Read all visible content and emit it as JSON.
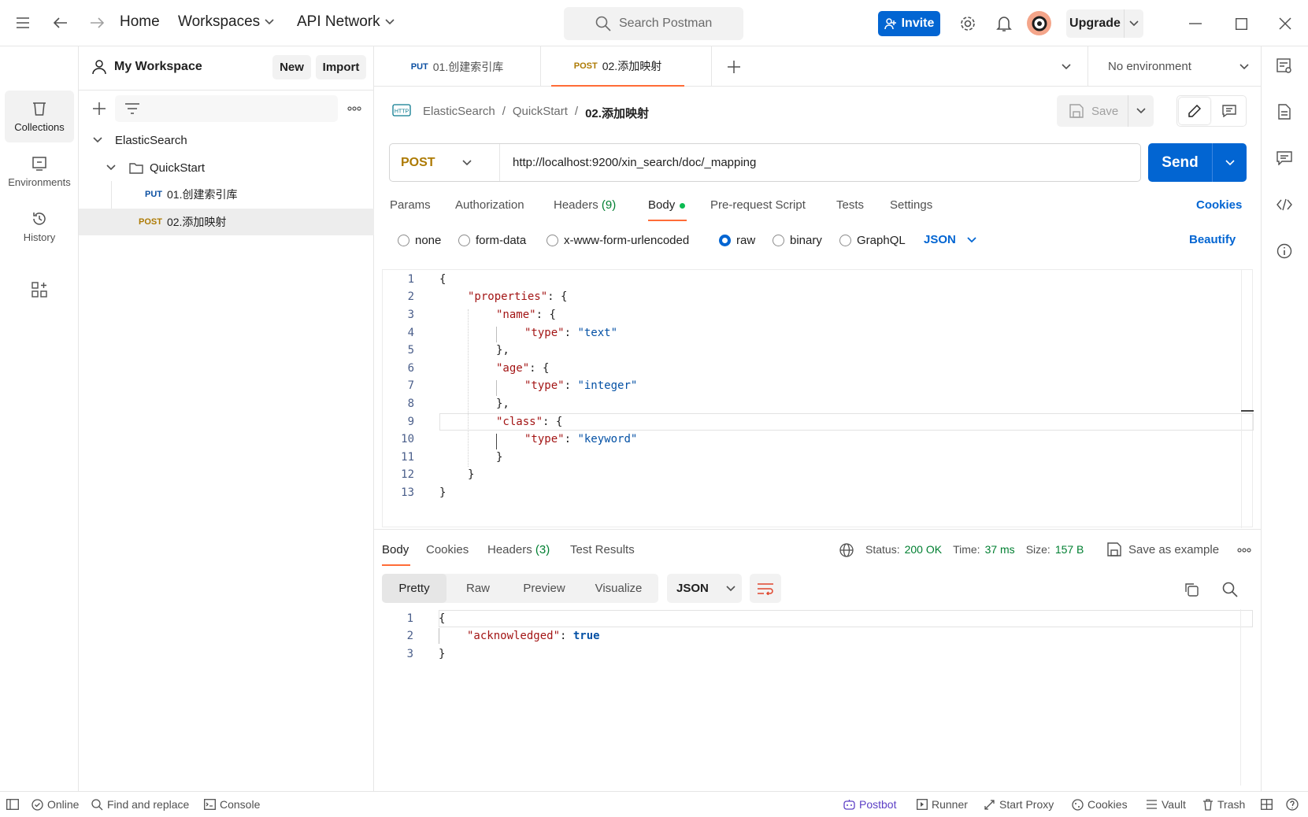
{
  "topbar": {
    "home": "Home",
    "workspaces": "Workspaces",
    "api_network": "API Network",
    "search_placeholder": "Search Postman",
    "invite": "Invite",
    "upgrade": "Upgrade"
  },
  "workspace": {
    "name": "My Workspace",
    "new_label": "New",
    "import_label": "Import"
  },
  "rail": {
    "collections": "Collections",
    "environments": "Environments",
    "history": "History"
  },
  "tree": {
    "collection": "ElasticSearch",
    "folder": "QuickStart",
    "items": [
      {
        "method": "PUT",
        "name": "01.创建索引库"
      },
      {
        "method": "POST",
        "name": "02.添加映射"
      }
    ]
  },
  "tabs": [
    {
      "method": "PUT",
      "name": "01.创建索引库"
    },
    {
      "method": "POST",
      "name": "02.添加映射"
    }
  ],
  "environment": "No environment",
  "breadcrumb": {
    "part1": "ElasticSearch",
    "part2": "QuickStart",
    "current": "02.添加映射"
  },
  "save_label": "Save",
  "request": {
    "method": "POST",
    "url": "http://localhost:9200/xin_search/doc/_mapping",
    "send": "Send"
  },
  "request_tabs": {
    "params": "Params",
    "authorization": "Authorization",
    "headers": "Headers",
    "headers_count": "(9)",
    "body": "Body",
    "prerequest": "Pre-request Script",
    "tests": "Tests",
    "settings": "Settings",
    "cookies": "Cookies"
  },
  "body_types": {
    "none": "none",
    "form_data": "form-data",
    "urlencoded": "x-www-form-urlencoded",
    "raw": "raw",
    "binary": "binary",
    "graphql": "GraphQL",
    "language": "JSON",
    "beautify": "Beautify"
  },
  "request_body": {
    "line1": "{",
    "line2_key": "\"properties\"",
    "line3_key": "\"name\"",
    "line4_key": "\"type\"",
    "line4_val": "\"text\"",
    "line5": "},",
    "line6_key": "\"age\"",
    "line7_key": "\"type\"",
    "line7_val": "\"integer\"",
    "line8": "},",
    "line9_key": "\"class\"",
    "line10_key": "\"type\"",
    "line10_val": "\"keyword\"",
    "line11": "}",
    "line12": "}",
    "line13": "}",
    "colon": ":",
    "brace": "{"
  },
  "response_tabs": {
    "body": "Body",
    "cookies": "Cookies",
    "headers": "Headers",
    "headers_count": "(3)",
    "test_results": "Test Results"
  },
  "response_meta": {
    "status_label": "Status:",
    "status_value": "200 OK",
    "time_label": "Time:",
    "time_value": "37 ms",
    "size_label": "Size:",
    "size_value": "157 B",
    "save_example": "Save as example"
  },
  "response_view": {
    "pretty": "Pretty",
    "raw": "Raw",
    "preview": "Preview",
    "visualize": "Visualize",
    "format": "JSON"
  },
  "response_body": {
    "line1": "{",
    "line2_key": "\"acknowledged\"",
    "line2_val": "true",
    "line3": "}"
  },
  "statusbar": {
    "online": "Online",
    "find_replace": "Find and replace",
    "console": "Console",
    "postbot": "Postbot",
    "runner": "Runner",
    "start_proxy": "Start Proxy",
    "cookies": "Cookies",
    "vault": "Vault",
    "trash": "Trash"
  },
  "colors": {
    "accent": "#0265d2",
    "orange": "#ff6c37",
    "status_green": "#007f31",
    "post": "#ad7a03",
    "put": "#0b4fa1"
  }
}
